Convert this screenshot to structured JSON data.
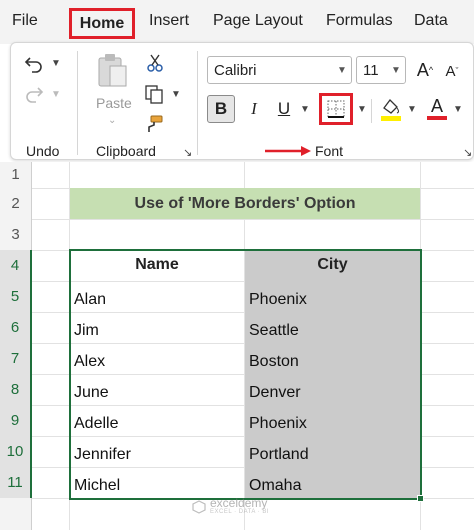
{
  "menu": {
    "tabs": [
      "File",
      "Home",
      "Insert",
      "Page Layout",
      "Formulas",
      "Data"
    ]
  },
  "ribbon": {
    "undo": {
      "label": "Undo"
    },
    "clipboard": {
      "label": "Clipboard",
      "paste_label": "Paste"
    },
    "font": {
      "label": "Font",
      "font_name": "Calibri",
      "font_size": "11",
      "grow": "A",
      "shrink": "A",
      "bold": "B",
      "italic": "I",
      "underline": "U",
      "font_color_letter": "A"
    },
    "colors": {
      "highlight": "#e0202a",
      "fill_swatch": "#ffef00",
      "font_swatch": "#e0202a",
      "header_fill": "#c6dfb2",
      "selection": "#1e6f3b",
      "grey_fill": "#cbcbcb"
    }
  },
  "sheet": {
    "row_numbers": [
      "1",
      "2",
      "3",
      "4",
      "5",
      "6",
      "7",
      "8",
      "9",
      "10",
      "11"
    ],
    "title": "Use of 'More Borders' Option",
    "headers": [
      "Name",
      "City"
    ],
    "rows": [
      [
        "Alan",
        "Phoenix"
      ],
      [
        "Jim",
        "Seattle"
      ],
      [
        "Alex",
        "Boston"
      ],
      [
        "June",
        "Denver"
      ],
      [
        "Adelle",
        "Phoenix"
      ],
      [
        "Jennifer",
        "Portland"
      ],
      [
        "Michel",
        "Omaha"
      ]
    ]
  },
  "watermark": {
    "name": "exceldemy",
    "tagline": "EXCEL · DATA · BI"
  }
}
